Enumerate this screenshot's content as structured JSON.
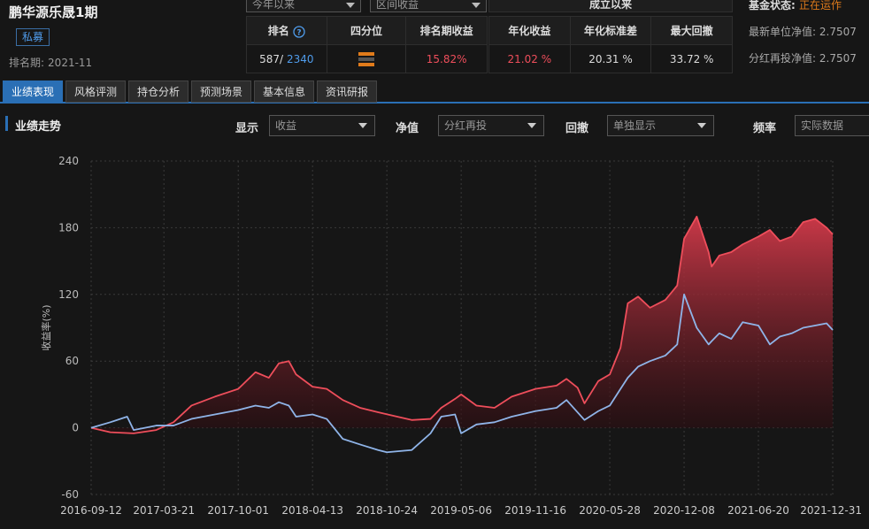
{
  "fund": {
    "name": "鹏华源乐晟1期",
    "tag": "私募",
    "rank_period_label": "排名期:",
    "rank_period_value": "2021-11"
  },
  "filters": {
    "period_select": "今年以来",
    "return_select": "区间收益",
    "since_label": "成立以来"
  },
  "stats_left": {
    "headers": [
      "排名",
      "四分位",
      "排名期收益"
    ],
    "rank": "587/",
    "rank_total": "2340",
    "period_return": "15.82%"
  },
  "stats_right": {
    "headers": [
      "年化收益",
      "年化标准差",
      "最大回撤"
    ],
    "values": [
      "21.02 %",
      "20.31 %",
      "33.72 %"
    ]
  },
  "status": {
    "state_label": "基金状态:",
    "state_value": "正在运作",
    "nav_label": "最新单位净值:",
    "nav_value": "2.7507",
    "cum_label": "分红再投净值:",
    "cum_value": "2.7507"
  },
  "tabs": [
    "业绩表现",
    "风格评测",
    "持仓分析",
    "预测场景",
    "基本信息",
    "资讯研报"
  ],
  "section_title": "业绩走势",
  "controls": {
    "show_label": "显示",
    "show_value": "收益",
    "nav_label": "净值",
    "nav_value": "分红再投",
    "drawdown_label": "回撤",
    "drawdown_value": "单独显示",
    "freq_label": "频率",
    "freq_value": "实际数据"
  },
  "colors": {
    "fund": "#ee4e5b",
    "benchmark": "#8fb4e8",
    "accent": "#2a6fb5"
  },
  "chart_data": {
    "type": "line",
    "ylabel": "收益率(%)",
    "ylim": [
      -60,
      240
    ],
    "yticks": [
      240,
      180,
      120,
      60,
      0,
      -60
    ],
    "xticks": [
      "2016-09-12",
      "2017-03-21",
      "2017-10-01",
      "2018-04-13",
      "2018-10-24",
      "2019-05-06",
      "2019-11-16",
      "2020-05-28",
      "2020-12-08",
      "2021-06-20",
      "2021-12-31"
    ],
    "xrange": [
      "2016-09-12",
      "2021-12-31"
    ],
    "grid": true,
    "series": [
      {
        "name": "",
        "style": "area",
        "x": [
          "2016-09-12",
          "2016-11-01",
          "2017-01-01",
          "2017-03-01",
          "2017-04-15",
          "2017-06-01",
          "2017-08-01",
          "2017-10-01",
          "2017-11-15",
          "2017-12-20",
          "2018-01-15",
          "2018-02-10",
          "2018-03-01",
          "2018-04-13",
          "2018-05-20",
          "2018-07-01",
          "2018-08-15",
          "2018-10-01",
          "2018-11-20",
          "2018-12-28",
          "2019-02-15",
          "2019-03-15",
          "2019-04-20",
          "2019-05-06",
          "2019-06-15",
          "2019-08-01",
          "2019-09-15",
          "2019-11-16",
          "2020-01-10",
          "2020-02-05",
          "2020-03-05",
          "2020-03-23",
          "2020-04-28",
          "2020-05-28",
          "2020-06-25",
          "2020-07-14",
          "2020-08-10",
          "2020-09-10",
          "2020-10-20",
          "2020-11-20",
          "2020-12-08",
          "2021-01-10",
          "2021-02-10",
          "2021-02-18",
          "2021-03-10",
          "2021-04-10",
          "2021-05-10",
          "2021-06-20",
          "2021-07-20",
          "2021-08-15",
          "2021-09-15",
          "2021-10-15",
          "2021-11-15",
          "2021-12-15",
          "2021-12-31"
        ],
        "values": [
          0,
          -4,
          -5,
          -2,
          5,
          20,
          28,
          35,
          50,
          45,
          58,
          60,
          48,
          37,
          35,
          25,
          18,
          14,
          10,
          7,
          8,
          18,
          26,
          30,
          20,
          18,
          28,
          35,
          38,
          44,
          36,
          22,
          42,
          48,
          72,
          112,
          118,
          108,
          115,
          128,
          170,
          190,
          158,
          145,
          155,
          158,
          165,
          172,
          178,
          168,
          172,
          185,
          188,
          180,
          174
        ]
      },
      {
        "name": "",
        "style": "line",
        "x": [
          "2016-09-12",
          "2016-11-01",
          "2016-12-15",
          "2017-01-01",
          "2017-03-01",
          "2017-04-15",
          "2017-06-01",
          "2017-08-01",
          "2017-10-01",
          "2017-11-15",
          "2017-12-20",
          "2018-01-15",
          "2018-02-10",
          "2018-03-01",
          "2018-04-13",
          "2018-05-20",
          "2018-07-01",
          "2018-08-15",
          "2018-10-01",
          "2018-10-24",
          "2018-12-28",
          "2019-02-15",
          "2019-03-15",
          "2019-04-20",
          "2019-05-06",
          "2019-06-15",
          "2019-08-01",
          "2019-09-15",
          "2019-11-16",
          "2020-01-10",
          "2020-02-05",
          "2020-03-23",
          "2020-04-28",
          "2020-05-28",
          "2020-06-25",
          "2020-07-14",
          "2020-08-10",
          "2020-09-10",
          "2020-10-20",
          "2020-11-20",
          "2020-12-08",
          "2021-01-10",
          "2021-02-10",
          "2021-02-18",
          "2021-03-10",
          "2021-04-10",
          "2021-05-10",
          "2021-06-20",
          "2021-07-20",
          "2021-08-15",
          "2021-09-15",
          "2021-10-15",
          "2021-11-15",
          "2021-12-15",
          "2021-12-31"
        ],
        "values": [
          0,
          5,
          10,
          -2,
          2,
          2,
          8,
          12,
          16,
          20,
          18,
          23,
          20,
          10,
          12,
          8,
          -10,
          -15,
          -20,
          -22,
          -20,
          -5,
          10,
          12,
          -5,
          3,
          5,
          10,
          15,
          18,
          25,
          7,
          15,
          20,
          35,
          45,
          55,
          60,
          65,
          75,
          120,
          90,
          75,
          78,
          85,
          80,
          95,
          92,
          75,
          82,
          85,
          90,
          92,
          94,
          88
        ]
      }
    ]
  }
}
